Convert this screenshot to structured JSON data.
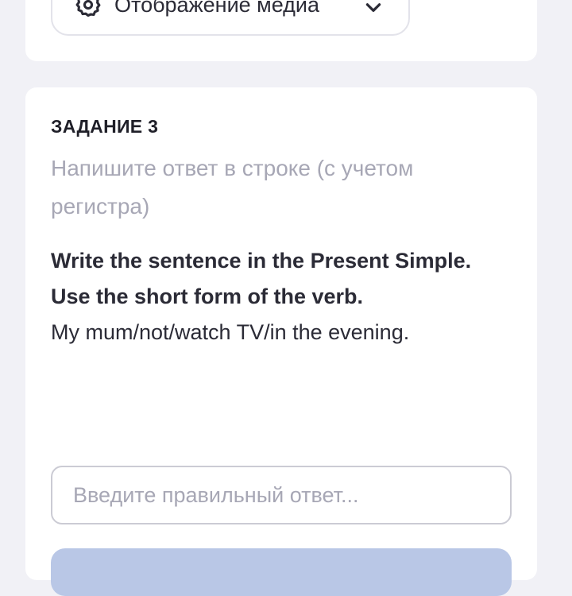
{
  "media_button": {
    "label": "Отображение медиа",
    "icon": "gear-icon",
    "chevron": "chevron-down-icon"
  },
  "task": {
    "title": "ЗАДАНИЕ 3",
    "hint": "Напишите ответ в строке (с учетом регистра)",
    "instruction_bold_1": "Write the sentence in the Present Simple.",
    "instruction_bold_2": "Use the short form of the verb.",
    "sentence": "My mum/not/watch TV/in the evening.",
    "answer": {
      "value": "",
      "placeholder": "Введите правильный ответ..."
    }
  },
  "colors": {
    "background": "#f1f1f6",
    "card": "#ffffff",
    "hint_text": "#a7a7b5",
    "submit_button": "#b9c7e6"
  }
}
